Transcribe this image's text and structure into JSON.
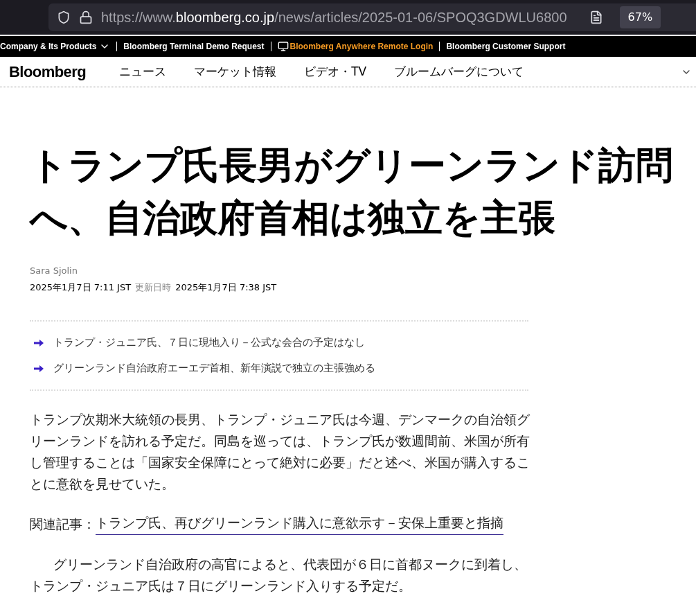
{
  "browser": {
    "url_prefix": "https://www.",
    "url_host": "bloomberg.co.jp",
    "url_path": "/news/articles/2025-01-06/SPOQ3GDWLU6800",
    "zoom": "67%"
  },
  "top_links": [
    {
      "label": "Company & Its Products",
      "kind": "dropdown"
    },
    {
      "label": "Bloomberg Terminal Demo Request",
      "kind": "plain"
    },
    {
      "label": "Bloomberg Anywhere Remote Login",
      "kind": "highlight"
    },
    {
      "label": "Bloomberg Customer Support",
      "kind": "plain"
    }
  ],
  "nav": {
    "logo": "Bloomberg",
    "items": [
      "ニュース",
      "マーケット情報",
      "ビデオ・TV",
      "ブルームバーグについて"
    ]
  },
  "article": {
    "headline": "トランプ氏長男がグリーンランド訪問へ、自治政府首相は独立を主張",
    "author": "Sara Sjolin",
    "published": "2025年1月7日 7:11 JST",
    "updated_label": "更新日時",
    "updated": "2025年1月7日 7:38 JST",
    "bullets": [
      "トランプ・ジュニア氏、７日に現地入り－公式な会合の予定はなし",
      "グリーンランド自治政府エーエデ首相、新年演説で独立の主張強める"
    ],
    "paragraphs": [
      {
        "kind": "text",
        "text": "トランプ次期米大統領の長男、トランプ・ジュニア氏は今週、デンマークの自治領グリーンランドを訪れる予定だ。同島を巡っては、トランプ氏が数週間前、米国が所有し管理することは「国家安全保障にとって絶対に必要」だと述べ、米国が購入することに意欲を見せていた。"
      },
      {
        "kind": "related",
        "label": "関連記事：",
        "link": "トランプ氏、再びグリーンランド購入に意欲示す－安保上重要と指摘"
      },
      {
        "kind": "indented",
        "text": "グリーンランド自治政府の高官によると、代表団が６日に首都ヌークに到着し、トランプ・ジュニア氏は７日にグリーンランド入りする予定だ。"
      }
    ]
  }
}
